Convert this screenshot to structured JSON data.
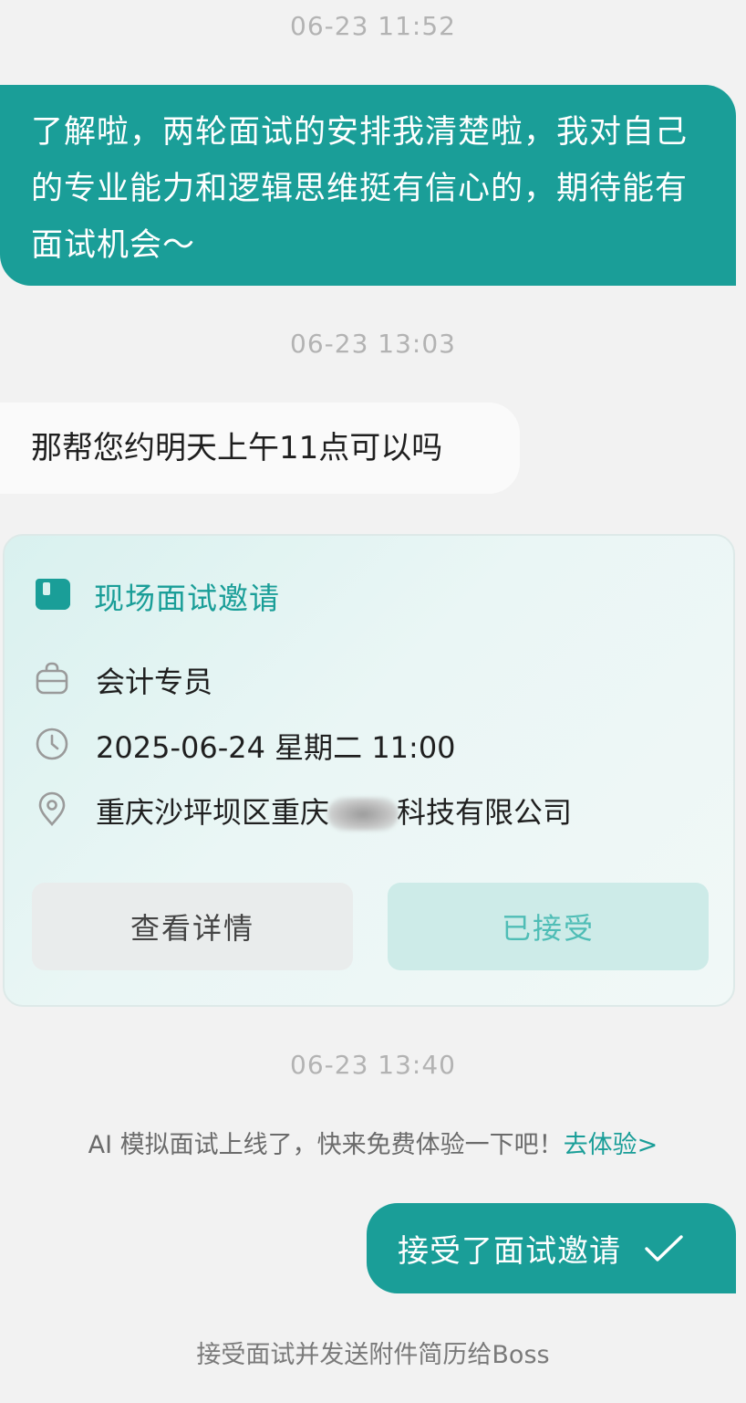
{
  "chat": {
    "timestamps": [
      "06-23 11:52",
      "06-23 13:03",
      "06-23 13:40"
    ],
    "messages": [
      {
        "from": "me",
        "text": "了解啦，两轮面试的安排我清楚啦，我对自己的专业能力和逻辑思维挺有信心的，期待能有面试机会～"
      },
      {
        "from": "other",
        "text": "那帮您约明天上午11点可以吗"
      }
    ]
  },
  "invite_card": {
    "title": "现场面试邀请",
    "title_icon": "interview-icon",
    "position": "会计专员",
    "position_icon": "briefcase-icon",
    "datetime": "2025-06-24 星期二 11:00",
    "datetime_icon": "clock-icon",
    "address_prefix": "重庆沙坪坝区重庆",
    "address_suffix": "科技有限公司",
    "address_icon": "location-pin-icon",
    "detail_button": "查看详情",
    "status_button": "已接受"
  },
  "ai_promo": {
    "text": "AI 模拟面试上线了，快来免费体验一下吧！",
    "link": "去体验>"
  },
  "accepted_message": {
    "text": "接受了面试邀请",
    "icon": "check-icon"
  },
  "footer_note": "接受面试并发送附件简历给Boss",
  "colors": {
    "accent": "#1a9e98",
    "background": "#f2f2f2",
    "incoming_bubble": "#fafafa",
    "accepted_button_bg": "#cdebe8",
    "accepted_button_text": "#4fbdb6"
  }
}
